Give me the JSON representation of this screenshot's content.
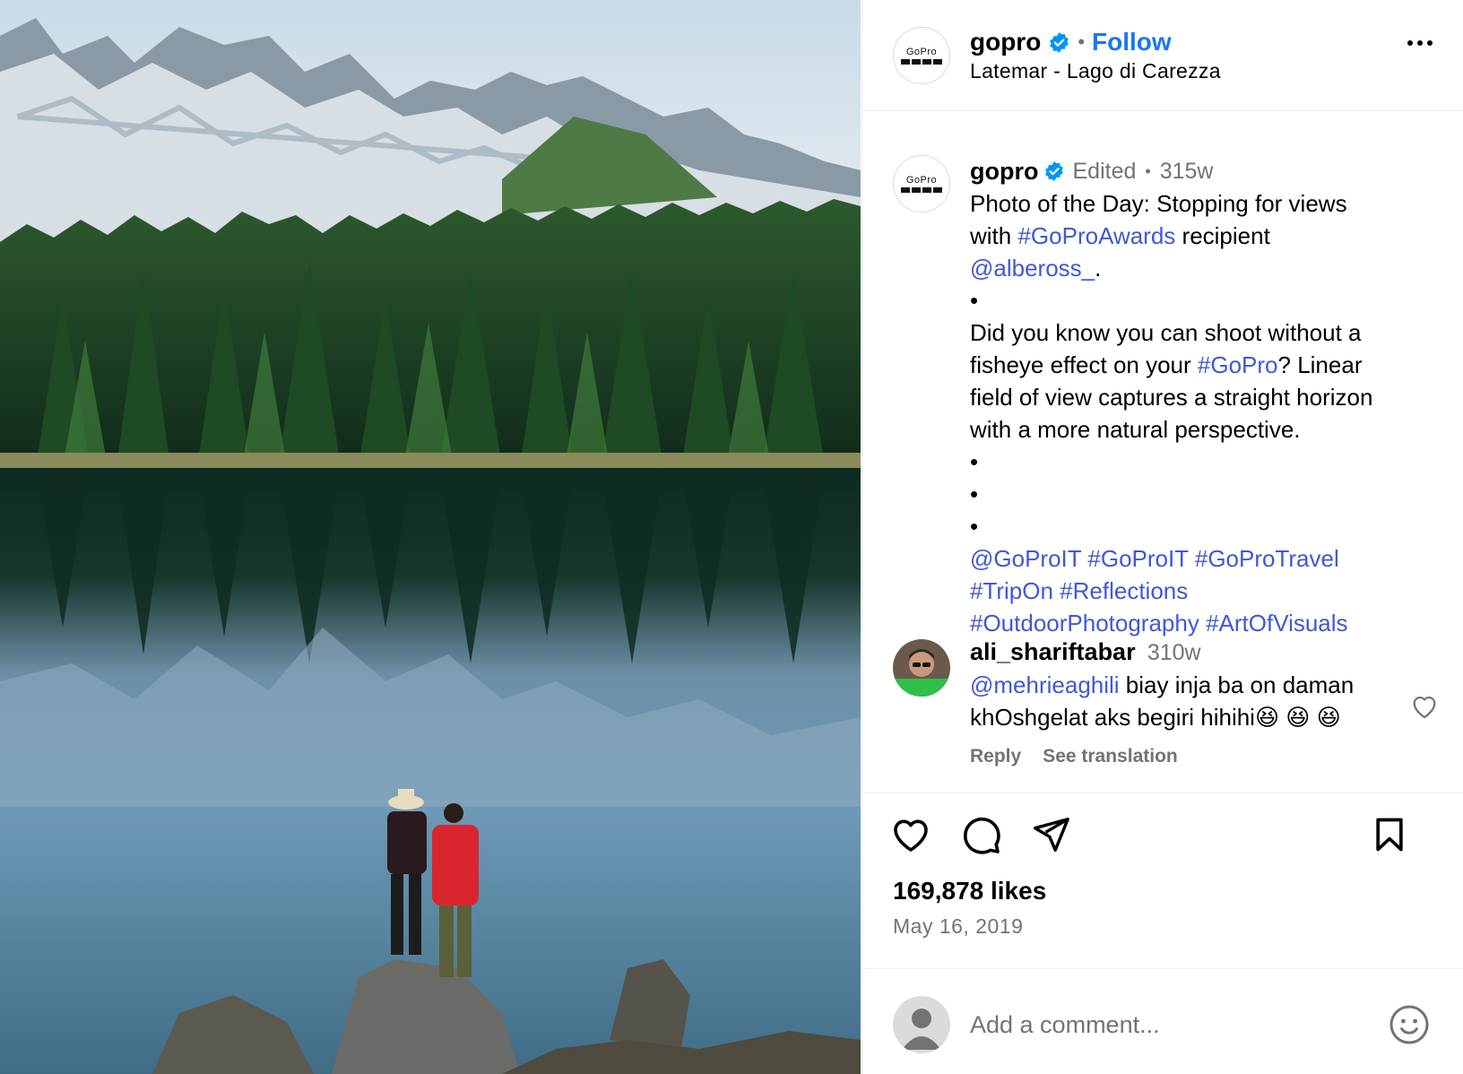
{
  "post": {
    "username": "gopro",
    "follow_label": "Follow",
    "location": "Latemar - Lago di Carezza",
    "avatar_wordmark": "GoPro"
  },
  "caption": {
    "username": "gopro",
    "edited": "Edited",
    "age": "315w",
    "lines": [
      "Photo of the Day: Stopping for views",
      "with ",
      "#GoProAwards",
      " recipient",
      "@albeross_",
      ".",
      "•",
      "Did you know you can shoot without a",
      "fisheye effect on your ",
      "#GoPro",
      "? Linear",
      "field of view captures a straight horizon",
      "with a more natural perspective.",
      "•",
      "•",
      "•",
      "@GoProIT #GoProIT #GoProTravel",
      "#TripOn #Reflections",
      "#OutdoorPhotography #ArtOfVisuals"
    ]
  },
  "comment": {
    "username": "ali_shariftabar",
    "age": "310w",
    "mention": "@mehrieaghili",
    "text_1": " biay inja ba on daman",
    "text_2": "khOshgelat aks begiri hihihi😆 😆 😆",
    "reply_label": "Reply",
    "translate_label": "See translation"
  },
  "stats": {
    "likes": "169,878 likes",
    "date": "May 16, 2019"
  },
  "add_comment": {
    "placeholder": "Add a comment..."
  },
  "colors": {
    "link": "#3f58d6",
    "follow": "#1877f2",
    "muted": "#737373",
    "verified": "#0095f6"
  }
}
